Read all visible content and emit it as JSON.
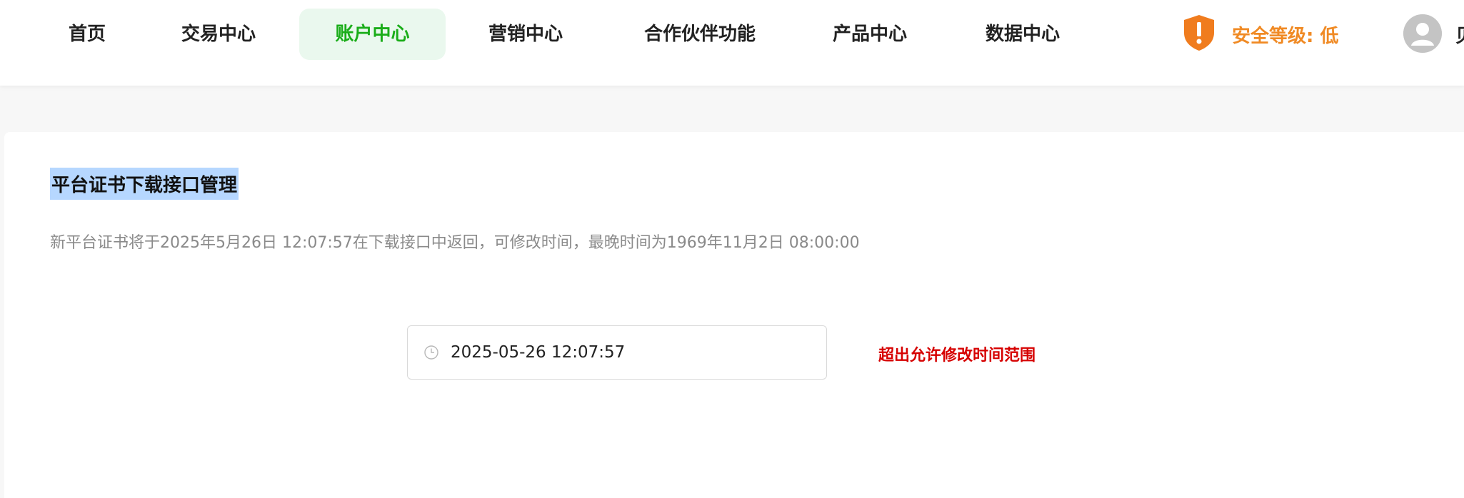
{
  "nav": {
    "items": [
      {
        "label": "首页",
        "active": false
      },
      {
        "label": "交易中心",
        "active": false
      },
      {
        "label": "账户中心",
        "active": true
      },
      {
        "label": "营销中心",
        "active": false
      },
      {
        "label": "合作伙伴功能",
        "active": false
      },
      {
        "label": "产品中心",
        "active": false
      },
      {
        "label": "数据中心",
        "active": false
      }
    ]
  },
  "security": {
    "label": "安全等级: 低",
    "icon": "shield-warning-icon",
    "color": "#f08a24"
  },
  "user": {
    "avatar_icon": "user-avatar-icon",
    "name_partial": "贝"
  },
  "page": {
    "title": "平台证书下载接口管理",
    "description": "新平台证书将于2025年5月26日 12:07:57在下载接口中返回，可修改时间，最晚时间为1969年11月2日 08:00:00"
  },
  "datetime_field": {
    "value": "2025-05-26 12:07:57",
    "icon": "clock-icon"
  },
  "validation": {
    "error": "超出允许修改时间范围",
    "color": "#d60000"
  },
  "colors": {
    "accent": "#1aad19",
    "active_bg": "#eaf8ee",
    "warning": "#f08a24"
  }
}
